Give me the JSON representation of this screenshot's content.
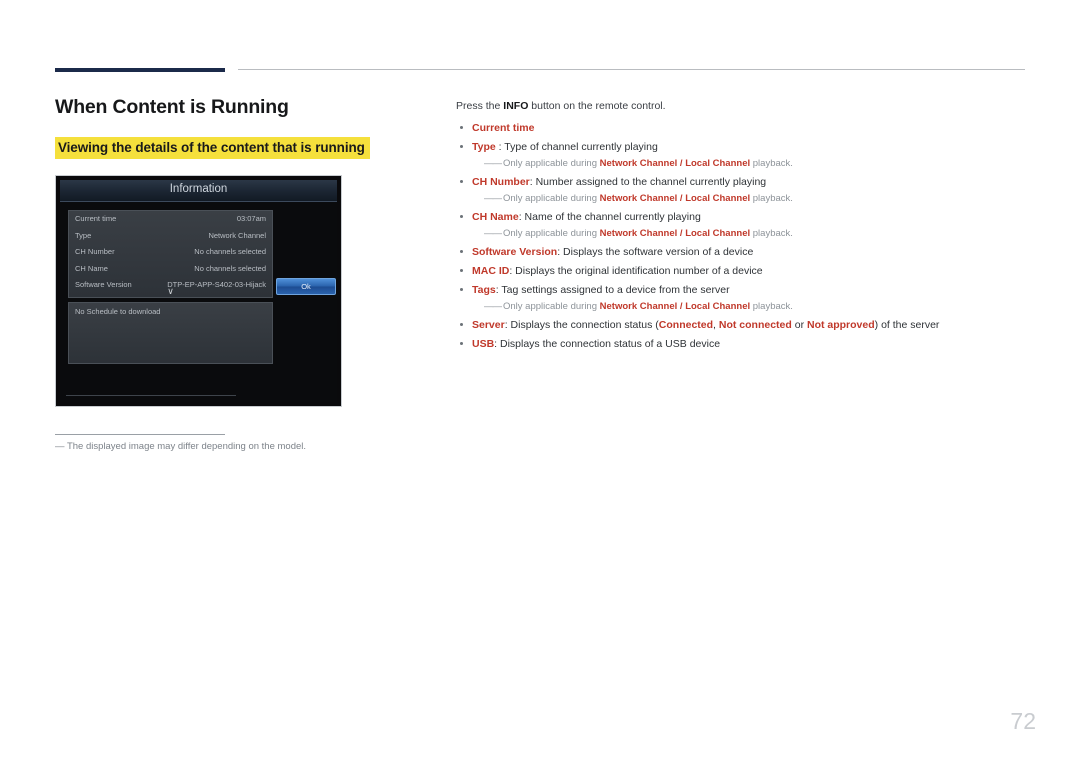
{
  "left": {
    "title": "When Content is Running",
    "subtitle": "Viewing the details of the content that is running",
    "note_dash": "―",
    "note_text": "The displayed image may differ depending on the model."
  },
  "tv": {
    "header": "Information",
    "rows": [
      {
        "key": "Current time",
        "value": "03:07am"
      },
      {
        "key": "Type",
        "value": "Network Channel"
      },
      {
        "key": "CH Number",
        "value": "No channels selected"
      },
      {
        "key": "CH Name",
        "value": "No channels selected"
      },
      {
        "key": "Software Version",
        "value": "DTP-EP-APP-S402-03-Hijack"
      }
    ],
    "chevron": "∨",
    "ok_label": "Ok",
    "schedule_text": "No Schedule to download"
  },
  "right": {
    "intro_pre": "Press the ",
    "intro_bold": "INFO",
    "intro_post": " button on the remote control.",
    "items": [
      {
        "label": "Current time",
        "label_style": "red",
        "desc": "",
        "sub": null
      },
      {
        "label": "Type",
        "label_style": "red",
        "desc": " : Type of channel currently playing",
        "sub": {
          "pre": "Only applicable during ",
          "a": "Network Channel",
          "sep": " / ",
          "b": "Local Channel",
          "post": " playback."
        }
      },
      {
        "label": "CH Number",
        "label_style": "red",
        "desc": ": Number assigned to the channel currently playing",
        "sub": {
          "pre": "Only applicable during ",
          "a": "Network Channel",
          "sep": " / ",
          "b": "Local Channel",
          "post": " playback."
        }
      },
      {
        "label": "CH Name",
        "label_style": "red",
        "desc": ": Name of the channel currently playing",
        "sub": {
          "pre": "Only applicable during ",
          "a": "Network Channel",
          "sep": " / ",
          "b": "Local Channel",
          "post": " playback."
        }
      },
      {
        "label": "Software Version",
        "label_style": "red",
        "desc": ": Displays the software version of a device",
        "sub": null
      },
      {
        "label": "MAC ID",
        "label_style": "red",
        "desc": ": Displays the original identification number of a device",
        "sub": null
      },
      {
        "label": "Tags",
        "label_style": "red",
        "desc": ": Tag settings assigned to a device from the server",
        "sub": {
          "pre": "Only applicable during ",
          "a": "Network Channel",
          "sep": " / ",
          "b": "Local Channel",
          "post": " playback."
        }
      }
    ],
    "server_item": {
      "label": "Server",
      "pre": ": Displays the connection status (",
      "s1": "Connected",
      "c1": ", ",
      "s2": "Not connected",
      "c2": " or ",
      "s3": "Not approved",
      "post": ") of the server"
    },
    "usb_item": {
      "label": "USB",
      "desc": ": Displays the connection status of a USB device"
    }
  },
  "page_number": "72",
  "colors": {
    "accent_red": "#c0392b",
    "highlight_yellow": "#f5e03c",
    "rule_dark": "#1b2a4a"
  }
}
